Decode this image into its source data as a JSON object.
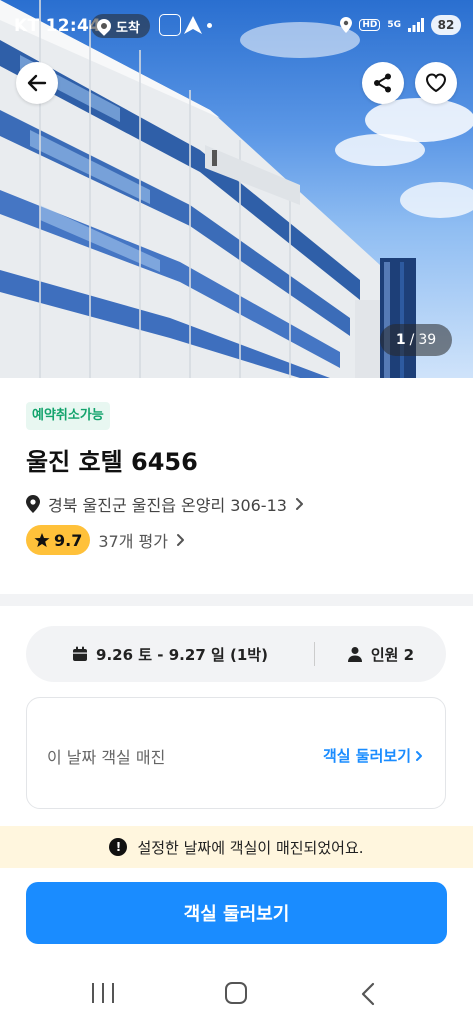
{
  "status_bar": {
    "carrier": "KT",
    "time": "12:44",
    "location_label": "도착",
    "battery": "82",
    "network": "5G",
    "hd_label": "HD"
  },
  "gallery": {
    "current": "1",
    "separator": "/",
    "total": "39"
  },
  "hotel": {
    "cancel_badge": "예약취소가능",
    "name": "울진 호텔 6456",
    "address": "경북 울진군 울진읍 온양리 306-13",
    "rating": "9.7",
    "review_count": "37개 평가"
  },
  "booking": {
    "dates": "9.26 토 - 9.27 일 (1박)",
    "guests": "인원 2"
  },
  "rooms": {
    "soldout_text": "이 날짜 객실 매진",
    "browse_link": "객실 둘러보기"
  },
  "notice": {
    "icon_symbol": "!",
    "text": "설정한 날짜에 객실이 매진되었어요."
  },
  "cta": {
    "label": "객실 둘러보기"
  },
  "colors": {
    "accent": "#1a8cff",
    "badge_green": "#12a36c",
    "rating_yellow": "#ffc13a",
    "notice_bg": "#fff6de"
  },
  "icons": {
    "back": "arrow-left-icon",
    "share": "share-icon",
    "favorite": "heart-icon",
    "address": "location-pin-icon",
    "rating": "star-icon",
    "calendar": "calendar-icon",
    "person": "person-icon"
  }
}
